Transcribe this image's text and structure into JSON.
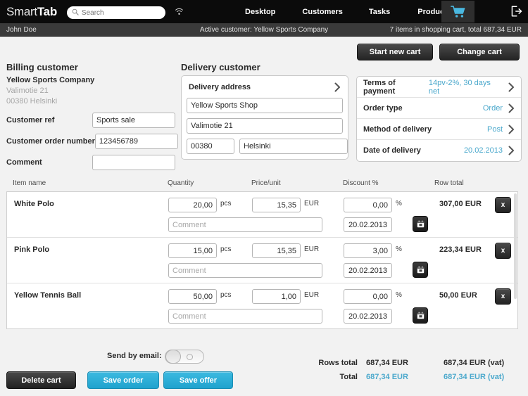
{
  "header": {
    "logo_light": "Smart",
    "logo_bold": "Tab",
    "search_placeholder": "Search",
    "search_value": "",
    "nav": [
      {
        "label": "Desktop"
      },
      {
        "label": "Customers"
      },
      {
        "label": "Tasks"
      },
      {
        "label": "Products"
      }
    ],
    "cart_icon": "shopping-cart-icon",
    "logout_icon": "logout-icon",
    "wifi_icon": "wifi-signal-icon",
    "accent_color": "#4aa8cc"
  },
  "statusbar": {
    "user": "John Doe",
    "active_customer": "Active customer: Yellow Sports Company",
    "cart_summary": "7 items in shopping cart, total 687,34 EUR"
  },
  "actions": {
    "start_new_cart": "Start new cart",
    "change_cart": "Change cart"
  },
  "billing": {
    "title": "Billing customer",
    "company": "Yellow Sports Company",
    "street": "Valimotie 21",
    "city": "00380 Helsinki",
    "fields": [
      {
        "label": "Customer ref",
        "value": "Sports sale"
      },
      {
        "label": "Customer order number",
        "value": "123456789"
      },
      {
        "label": "Comment",
        "value": ""
      }
    ]
  },
  "delivery": {
    "title": "Delivery customer",
    "panel_header": "Delivery address",
    "name": "Yellow Sports Shop",
    "street": "Valimotie 21",
    "zip": "00380",
    "city": "Helsinki"
  },
  "terms": {
    "rows": [
      {
        "label": "Terms of payment",
        "value": "14pv-2%, 30 days net"
      },
      {
        "label": "Order type",
        "value": "Order"
      },
      {
        "label": "Method of delivery",
        "value": "Post"
      },
      {
        "label": "Date of delivery",
        "value": "20.02.2013"
      }
    ]
  },
  "table": {
    "headers": {
      "item_name": "Item name",
      "quantity": "Quantity",
      "price_unit": "Price/unit",
      "discount": "Discount %",
      "row_total": "Row total"
    },
    "units": {
      "pcs": "pcs",
      "eur": "EUR",
      "pct": "%"
    },
    "comment_placeholder": "Comment",
    "remove_label": "x",
    "rows": [
      {
        "name": "White Polo",
        "quantity": "20,00",
        "price": "15,35",
        "discount": "0,00",
        "comment": "",
        "date": "20.02.2013",
        "total": "307,00 EUR"
      },
      {
        "name": "Pink Polo",
        "quantity": "15,00",
        "price": "15,35",
        "discount": "3,00",
        "comment": "",
        "date": "20.02.2013",
        "total": "223,34 EUR"
      },
      {
        "name": "Yellow Tennis Ball",
        "quantity": "50,00",
        "price": "1,00",
        "discount": "0,00",
        "comment": "",
        "date": "20.02.2013",
        "total": "50,00 EUR"
      },
      {
        "name": "",
        "quantity": "",
        "price": "",
        "discount": "",
        "comment": "",
        "date": "",
        "total": ""
      }
    ]
  },
  "footer": {
    "send_by_email_label": "Send by email:",
    "send_by_email_state": "off",
    "delete_cart": "Delete cart",
    "save_order": "Save order",
    "save_offer": "Save offer",
    "totals": [
      {
        "label": "Rows total",
        "net": "687,34 EUR",
        "vat": "687,34 EUR (vat)",
        "highlight": false
      },
      {
        "label": "Total",
        "net": "687,34 EUR",
        "vat": "687,34 EUR (vat)",
        "highlight": true
      }
    ]
  }
}
